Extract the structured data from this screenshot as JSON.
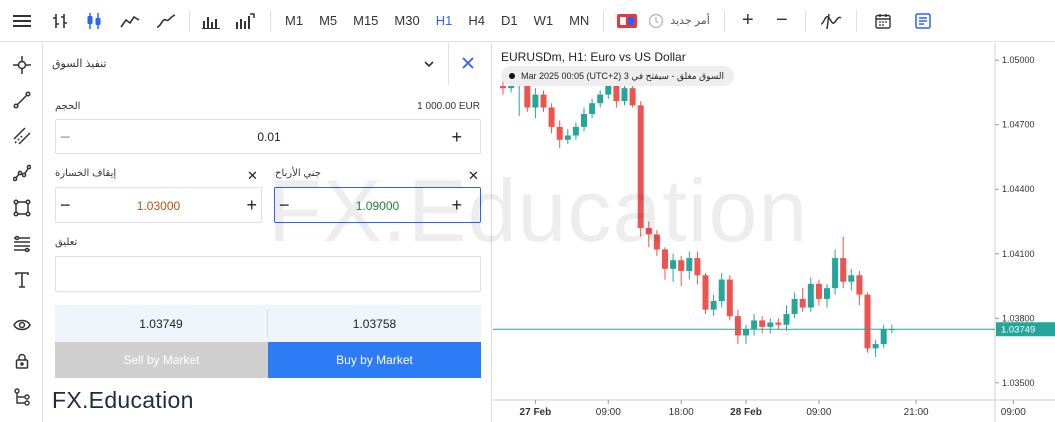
{
  "toolbar": {
    "timeframes": [
      {
        "label": "M1",
        "active": false
      },
      {
        "label": "M5",
        "active": false
      },
      {
        "label": "M15",
        "active": false
      },
      {
        "label": "M30",
        "active": false
      },
      {
        "label": "H1",
        "active": true
      },
      {
        "label": "H4",
        "active": false
      },
      {
        "label": "D1",
        "active": false
      },
      {
        "label": "W1",
        "active": false
      },
      {
        "label": "MN",
        "active": false
      }
    ],
    "new_order_label": "أمر جديد",
    "zoom_in": "+",
    "zoom_out": "−"
  },
  "order_panel": {
    "execution_type": "تنفيذ السوق",
    "volume_label": "الحجم",
    "volume_value_text": "1 000.00 EUR",
    "volume": "0.01",
    "stop_loss_label": "إيقاف الخسارة",
    "stop_loss": "1.03000",
    "take_profit_label": "جني الأرباح",
    "take_profit": "1.09000",
    "comment_label": "تعليق",
    "comment_value": "",
    "bid": "1.03749",
    "ask": "1.03758",
    "sell_label": "Sell by Market",
    "buy_label": "Buy by Market",
    "minus": "−",
    "plus": "+",
    "remove": "✕"
  },
  "brand": {
    "text": "FX.Education",
    "watermark": "FX.Education"
  },
  "chart": {
    "symbol_title": "EURUSDm, H1: Euro vs US Dollar",
    "market_status": "السوق مغلق - سيفتح في 3 Mar 2025 00:05 (UTC+2)",
    "current_price_label": "1.03749",
    "colors": {
      "up": "#26a69a",
      "down": "#ef5350",
      "price_line": "#26a69a"
    }
  },
  "chart_data": {
    "type": "candlestick",
    "symbol": "EURUSDm",
    "timeframe": "H1",
    "y_ticks": [
      1.035,
      1.038,
      1.041,
      1.044,
      1.047,
      1.05
    ],
    "y_tick_labels": [
      "1.03500",
      "1.03800",
      "1.04100",
      "1.04400",
      "1.04700",
      "1.05000"
    ],
    "x_ticks": [
      {
        "label": "27 Feb",
        "index": 4
      },
      {
        "label": "09:00",
        "index": 13
      },
      {
        "label": "18:00",
        "index": 22
      },
      {
        "label": "28 Feb",
        "index": 30
      },
      {
        "label": "09:00",
        "index": 39
      },
      {
        "label": "21:00",
        "index": 51
      },
      {
        "label": "09:00",
        "index": 63
      }
    ],
    "ylim": [
      1.0342,
      1.0508
    ],
    "current_price": 1.03749,
    "candles": [
      {
        "o": 1.0488,
        "h": 1.0491,
        "l": 1.0484,
        "c": 1.0487
      },
      {
        "o": 1.0487,
        "h": 1.049,
        "l": 1.0485,
        "c": 1.0488
      },
      {
        "o": 1.0488,
        "h": 1.0493,
        "l": 1.0474,
        "c": 1.0489
      },
      {
        "o": 1.0489,
        "h": 1.049,
        "l": 1.0476,
        "c": 1.0478
      },
      {
        "o": 1.0478,
        "h": 1.0487,
        "l": 1.0473,
        "c": 1.0484
      },
      {
        "o": 1.0484,
        "h": 1.0486,
        "l": 1.0476,
        "c": 1.0478
      },
      {
        "o": 1.0478,
        "h": 1.048,
        "l": 1.0466,
        "c": 1.0469
      },
      {
        "o": 1.0469,
        "h": 1.0472,
        "l": 1.0459,
        "c": 1.0463
      },
      {
        "o": 1.0463,
        "h": 1.0468,
        "l": 1.0461,
        "c": 1.0465
      },
      {
        "o": 1.0465,
        "h": 1.0471,
        "l": 1.0463,
        "c": 1.0469
      },
      {
        "o": 1.0469,
        "h": 1.0478,
        "l": 1.0467,
        "c": 1.0475
      },
      {
        "o": 1.0475,
        "h": 1.0482,
        "l": 1.0473,
        "c": 1.048
      },
      {
        "o": 1.048,
        "h": 1.0486,
        "l": 1.0478,
        "c": 1.0484
      },
      {
        "o": 1.0484,
        "h": 1.0491,
        "l": 1.0482,
        "c": 1.0489
      },
      {
        "o": 1.0489,
        "h": 1.049,
        "l": 1.0478,
        "c": 1.0481
      },
      {
        "o": 1.0481,
        "h": 1.0489,
        "l": 1.0479,
        "c": 1.0487
      },
      {
        "o": 1.0487,
        "h": 1.0495,
        "l": 1.0478,
        "c": 1.0479
      },
      {
        "o": 1.0479,
        "h": 1.0481,
        "l": 1.0418,
        "c": 1.0422
      },
      {
        "o": 1.0422,
        "h": 1.0425,
        "l": 1.0413,
        "c": 1.0419
      },
      {
        "o": 1.0419,
        "h": 1.0421,
        "l": 1.0409,
        "c": 1.0412
      },
      {
        "o": 1.0412,
        "h": 1.0413,
        "l": 1.0398,
        "c": 1.0403
      },
      {
        "o": 1.0403,
        "h": 1.041,
        "l": 1.0397,
        "c": 1.0407
      },
      {
        "o": 1.0407,
        "h": 1.0409,
        "l": 1.0395,
        "c": 1.0402
      },
      {
        "o": 1.0402,
        "h": 1.0411,
        "l": 1.0398,
        "c": 1.0408
      },
      {
        "o": 1.0408,
        "h": 1.0411,
        "l": 1.0396,
        "c": 1.04
      },
      {
        "o": 1.04,
        "h": 1.0401,
        "l": 1.0382,
        "c": 1.0384
      },
      {
        "o": 1.0384,
        "h": 1.0391,
        "l": 1.0381,
        "c": 1.0388
      },
      {
        "o": 1.0388,
        "h": 1.0401,
        "l": 1.0385,
        "c": 1.0398
      },
      {
        "o": 1.0398,
        "h": 1.04,
        "l": 1.0379,
        "c": 1.0381
      },
      {
        "o": 1.0381,
        "h": 1.0384,
        "l": 1.0368,
        "c": 1.0372
      },
      {
        "o": 1.0372,
        "h": 1.0377,
        "l": 1.0368,
        "c": 1.0375
      },
      {
        "o": 1.0375,
        "h": 1.0382,
        "l": 1.0372,
        "c": 1.0379
      },
      {
        "o": 1.0379,
        "h": 1.0381,
        "l": 1.0373,
        "c": 1.0376
      },
      {
        "o": 1.0376,
        "h": 1.038,
        "l": 1.0373,
        "c": 1.0378
      },
      {
        "o": 1.0378,
        "h": 1.038,
        "l": 1.0375,
        "c": 1.0377
      },
      {
        "o": 1.0377,
        "h": 1.0386,
        "l": 1.0374,
        "c": 1.0382
      },
      {
        "o": 1.0382,
        "h": 1.0392,
        "l": 1.038,
        "c": 1.0389
      },
      {
        "o": 1.0389,
        "h": 1.0394,
        "l": 1.0383,
        "c": 1.0385
      },
      {
        "o": 1.0385,
        "h": 1.0399,
        "l": 1.0383,
        "c": 1.0396
      },
      {
        "o": 1.0396,
        "h": 1.0398,
        "l": 1.0386,
        "c": 1.0389
      },
      {
        "o": 1.0389,
        "h": 1.0396,
        "l": 1.0385,
        "c": 1.0394
      },
      {
        "o": 1.0394,
        "h": 1.0412,
        "l": 1.0391,
        "c": 1.0408
      },
      {
        "o": 1.0408,
        "h": 1.0418,
        "l": 1.0394,
        "c": 1.0397
      },
      {
        "o": 1.0397,
        "h": 1.0403,
        "l": 1.0393,
        "c": 1.04
      },
      {
        "o": 1.04,
        "h": 1.0402,
        "l": 1.0386,
        "c": 1.0391
      },
      {
        "o": 1.0391,
        "h": 1.0392,
        "l": 1.0364,
        "c": 1.0366
      },
      {
        "o": 1.0366,
        "h": 1.037,
        "l": 1.0362,
        "c": 1.0368
      },
      {
        "o": 1.0368,
        "h": 1.0377,
        "l": 1.0366,
        "c": 1.0375
      },
      {
        "o": 1.0375,
        "h": 1.0377,
        "l": 1.0373,
        "c": 1.0375
      }
    ]
  }
}
